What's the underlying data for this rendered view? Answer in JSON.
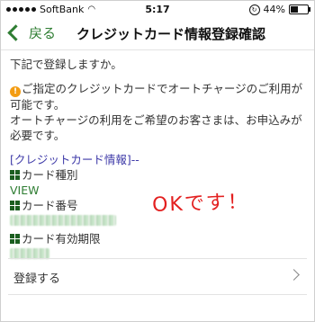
{
  "status": {
    "carrier": "SoftBank",
    "time": "5:17",
    "battery": "44%"
  },
  "nav": {
    "back_label": "戻る",
    "title": "クレジットカード情報登録確認"
  },
  "body": {
    "intro": "下記で登録しますか。",
    "notice_line1": "ご指定のクレジットカードでオートチャージのご利用が",
    "notice_line2": "可能です。",
    "notice_line3": "オートチャージの利用をご希望のお客さまは、お申込みが",
    "notice_line4": "必要です。",
    "section_header": "[クレジットカード情報]--",
    "card_type_label": "カード種別",
    "card_type_value": "VIEW",
    "card_number_label": "カード番号",
    "card_expiry_label": "カード有効期限"
  },
  "annotation": "OKです！",
  "register_label": "登録する"
}
